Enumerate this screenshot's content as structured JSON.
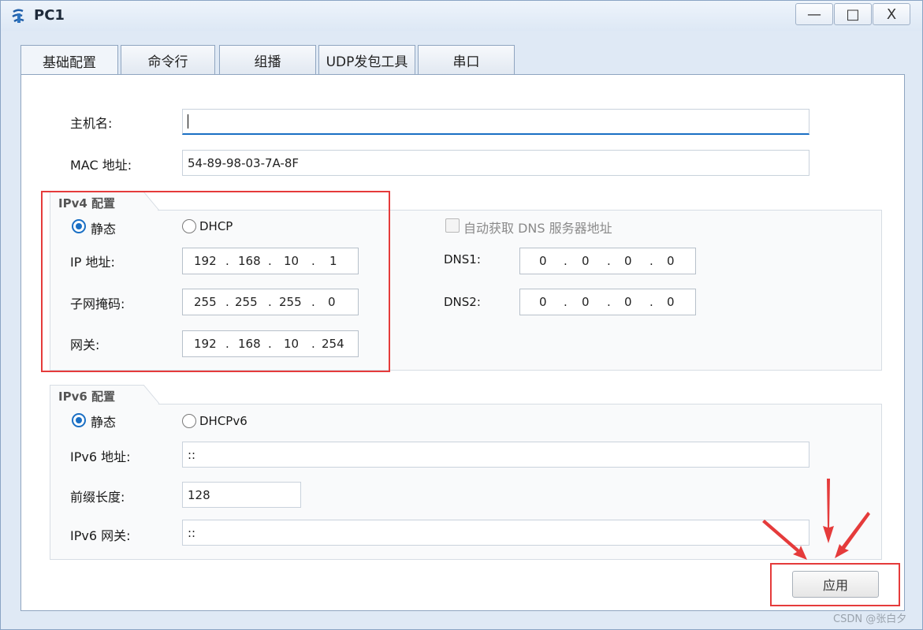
{
  "window": {
    "title": "PC1",
    "minimize_glyph": "—",
    "maximize_glyph": "□",
    "close_glyph": "X"
  },
  "tabs": [
    {
      "label": "基础配置",
      "active": true
    },
    {
      "label": "命令行",
      "active": false
    },
    {
      "label": "组播",
      "active": false
    },
    {
      "label": "UDP发包工具",
      "active": false
    },
    {
      "label": "串口",
      "active": false
    }
  ],
  "host": {
    "hostname_label": "主机名:",
    "hostname_value": "",
    "mac_label": "MAC 地址:",
    "mac_value": "54-89-98-03-7A-8F"
  },
  "ipv4": {
    "group_title": "IPv4 配置",
    "static_label": "静态",
    "dhcp_label": "DHCP",
    "mode": "static",
    "auto_dns_label": "自动获取 DNS 服务器地址",
    "auto_dns_checked": false,
    "ip_label": "IP 地址:",
    "ip": [
      "192",
      "168",
      "10",
      "1"
    ],
    "mask_label": "子网掩码:",
    "mask": [
      "255",
      "255",
      "255",
      "0"
    ],
    "gateway_label": "网关:",
    "gateway": [
      "192",
      "168",
      "10",
      "254"
    ],
    "dns1_label": "DNS1:",
    "dns1": [
      "0",
      "0",
      "0",
      "0"
    ],
    "dns2_label": "DNS2:",
    "dns2": [
      "0",
      "0",
      "0",
      "0"
    ]
  },
  "ipv6": {
    "group_title": "IPv6 配置",
    "static_label": "静态",
    "dhcp_label": "DHCPv6",
    "mode": "static",
    "address_label": "IPv6 地址:",
    "address_value": "::",
    "prefix_label": "前缀长度:",
    "prefix_value": "128",
    "gateway_label": "IPv6 网关:",
    "gateway_value": "::"
  },
  "apply_label": "应用",
  "watermark": "CSDN @张白夕",
  "colors": {
    "accent": "#1a6fc4",
    "annotation": "#e53b3b"
  }
}
